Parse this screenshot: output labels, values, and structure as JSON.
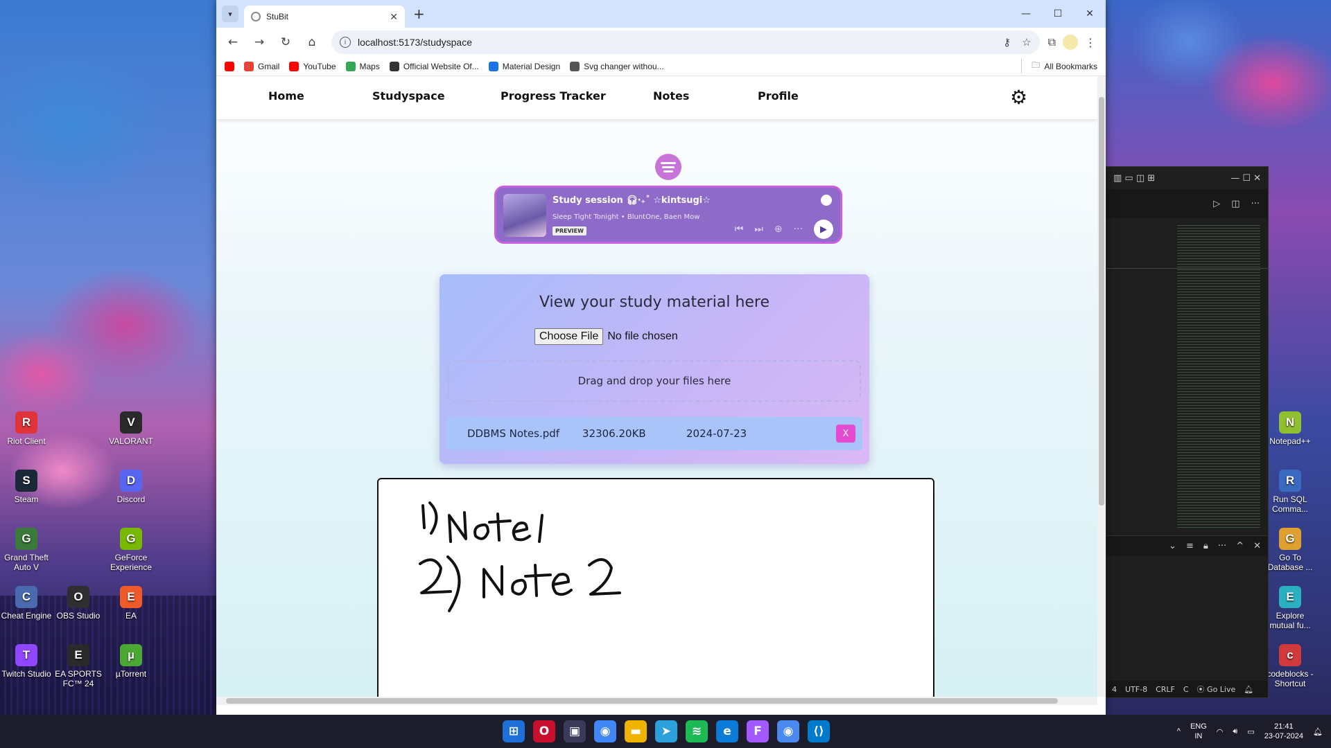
{
  "desktop": {
    "left_icons": [
      {
        "label": "Riot Client",
        "color": "#e0343a"
      },
      {
        "label": "VALORANT",
        "color": "#2a2a2a"
      },
      {
        "label": "Steam",
        "color": "#1b2838"
      },
      {
        "label": "Discord",
        "color": "#5865f2"
      },
      {
        "label": "Grand Theft Auto V",
        "color": "#3a7a3a"
      },
      {
        "label": "GeForce Experience",
        "color": "#76b900"
      },
      {
        "label": "Cheat Engine",
        "color": "#4a6ab0"
      },
      {
        "label": "OBS Studio",
        "color": "#302e31"
      },
      {
        "label": "EA",
        "color": "#f05a28"
      },
      {
        "label": "Twitch Studio",
        "color": "#9146ff"
      },
      {
        "label": "EA SPORTS FC™ 24",
        "color": "#2a2a2a"
      },
      {
        "label": "µTorrent",
        "color": "#4ba833"
      }
    ],
    "right_icons": [
      {
        "label": "Notepad++",
        "color": "#90c030"
      },
      {
        "label": "Run SQL Comma...",
        "color": "#3a6ac0"
      },
      {
        "label": "Go To Database ...",
        "color": "#e0a030"
      },
      {
        "label": "Explore mutual fu...",
        "color": "#2ab0c0"
      },
      {
        "label": "codeblocks - Shortcut",
        "color": "#d03a3a"
      }
    ]
  },
  "vscode": {
    "statusbar": [
      "4",
      "UTF-8",
      "CRLF",
      "C",
      "Go Live"
    ]
  },
  "browser": {
    "tab_title": "StuBit",
    "url": "localhost:5173/studyspace",
    "bookmarks": [
      {
        "label": "Gmail",
        "color": "#ea4335"
      },
      {
        "label": "YouTube",
        "color": "#ff0000"
      },
      {
        "label": "Maps",
        "color": "#34a853"
      },
      {
        "label": "Official Website Of...",
        "color": "#333333"
      },
      {
        "label": "Material Design",
        "color": "#1a73e8"
      },
      {
        "label": "Svg changer withou...",
        "color": "#555555"
      }
    ],
    "all_bookmarks": "All Bookmarks"
  },
  "nav": {
    "home": "Home",
    "studyspace": "Studyspace",
    "progress": "Progress Tracker",
    "notes": "Notes",
    "profile": "Profile"
  },
  "player": {
    "title": "Study session 🎧︎‧₊˚ ☆kintsugi☆",
    "track": "Sleep Tight Tonight",
    "artists": "BluntOne, Baen Mow",
    "badge": "PREVIEW"
  },
  "study": {
    "heading": "View your study material here",
    "choose_label": "Choose File",
    "no_file": "No file chosen",
    "drop_text": "Drag and drop your files here",
    "files": [
      {
        "name": "DDBMS Notes.pdf",
        "size": "32306.20KB",
        "date": "2024-07-23",
        "delete": "X"
      }
    ]
  },
  "notes_canvas": {
    "lines": [
      "1) Note 1",
      "2) Note 2"
    ]
  },
  "taskbar": {
    "lang": "ENG",
    "region": "IN",
    "time": "21:41",
    "date": "23-07-2024"
  }
}
